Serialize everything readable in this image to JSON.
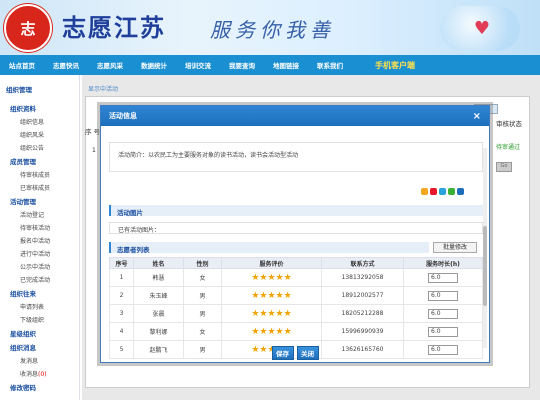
{
  "header": {
    "logo_text": "志",
    "brand": "志愿江苏",
    "slogan": "服务你我善"
  },
  "nav": {
    "items": [
      "站点首页",
      "志愿快讯",
      "志愿风采",
      "数据统计",
      "培训交流",
      "我要查询",
      "地图链接",
      "联系我们"
    ],
    "mobile": "手机客户端"
  },
  "sidebar": {
    "title": "组织管理",
    "groups": [
      {
        "label": "组织资料",
        "items": [
          "组织信息",
          "组织风采",
          "组织公告"
        ]
      },
      {
        "label": "成员管理",
        "items": [
          "待审核成员",
          "已审核成员"
        ]
      },
      {
        "label": "活动管理",
        "items": [
          "活动登记",
          "待审核活动",
          "报名中活动",
          "进行中活动",
          "公示中活动",
          "已完成活动"
        ]
      },
      {
        "label": "组织往来",
        "items": [
          "申请列表",
          "下级组织"
        ]
      },
      {
        "label": "星级组织",
        "items": []
      },
      {
        "label": "组织消息",
        "items": [
          "发消息",
          "收消息"
        ]
      },
      {
        "label": "修改密码",
        "items": []
      }
    ],
    "unread_count": "(0)"
  },
  "main": {
    "breadcrumb": "显示中活动",
    "bg_seq": "序 号",
    "bg_row_one": "1",
    "bg_right_header": "审核状态",
    "bg_status": "待审通过",
    "bg_go": "Go"
  },
  "modal": {
    "title": "活动信息",
    "close": "×",
    "description": "活动简介：以农民工为主要服务对象的读书活动，读书会活动型活动",
    "photos_section": "活动图片",
    "photos_label": "已有活动图片：",
    "volunteer_section": "志愿者列表",
    "batch_edit": "批量修改",
    "columns": [
      "序号",
      "姓名",
      "性别",
      "服务评价",
      "联系方式",
      "服务时长(h)"
    ],
    "rows": [
      {
        "no": "1",
        "name": "韩慧",
        "gender": "女",
        "rating": 5,
        "phone": "13813292058",
        "hours": "6.0"
      },
      {
        "no": "2",
        "name": "朱玉峰",
        "gender": "男",
        "rating": 5,
        "phone": "18912002577",
        "hours": "6.0"
      },
      {
        "no": "3",
        "name": "张晨",
        "gender": "男",
        "rating": 5,
        "phone": "18205212288",
        "hours": "6.0"
      },
      {
        "no": "4",
        "name": "黎利娜",
        "gender": "女",
        "rating": 5,
        "phone": "15996990939",
        "hours": "6.0"
      },
      {
        "no": "5",
        "name": "赵鹏飞",
        "gender": "男",
        "rating": 5,
        "phone": "13626165760",
        "hours": "6.0"
      }
    ],
    "save": "保存",
    "close_btn": "关闭"
  },
  "colors": {
    "nav_bg": "#1a8fd1",
    "accent": "#2f86d4",
    "star": "#f2a300",
    "mobile_link": "#ffe14c"
  }
}
